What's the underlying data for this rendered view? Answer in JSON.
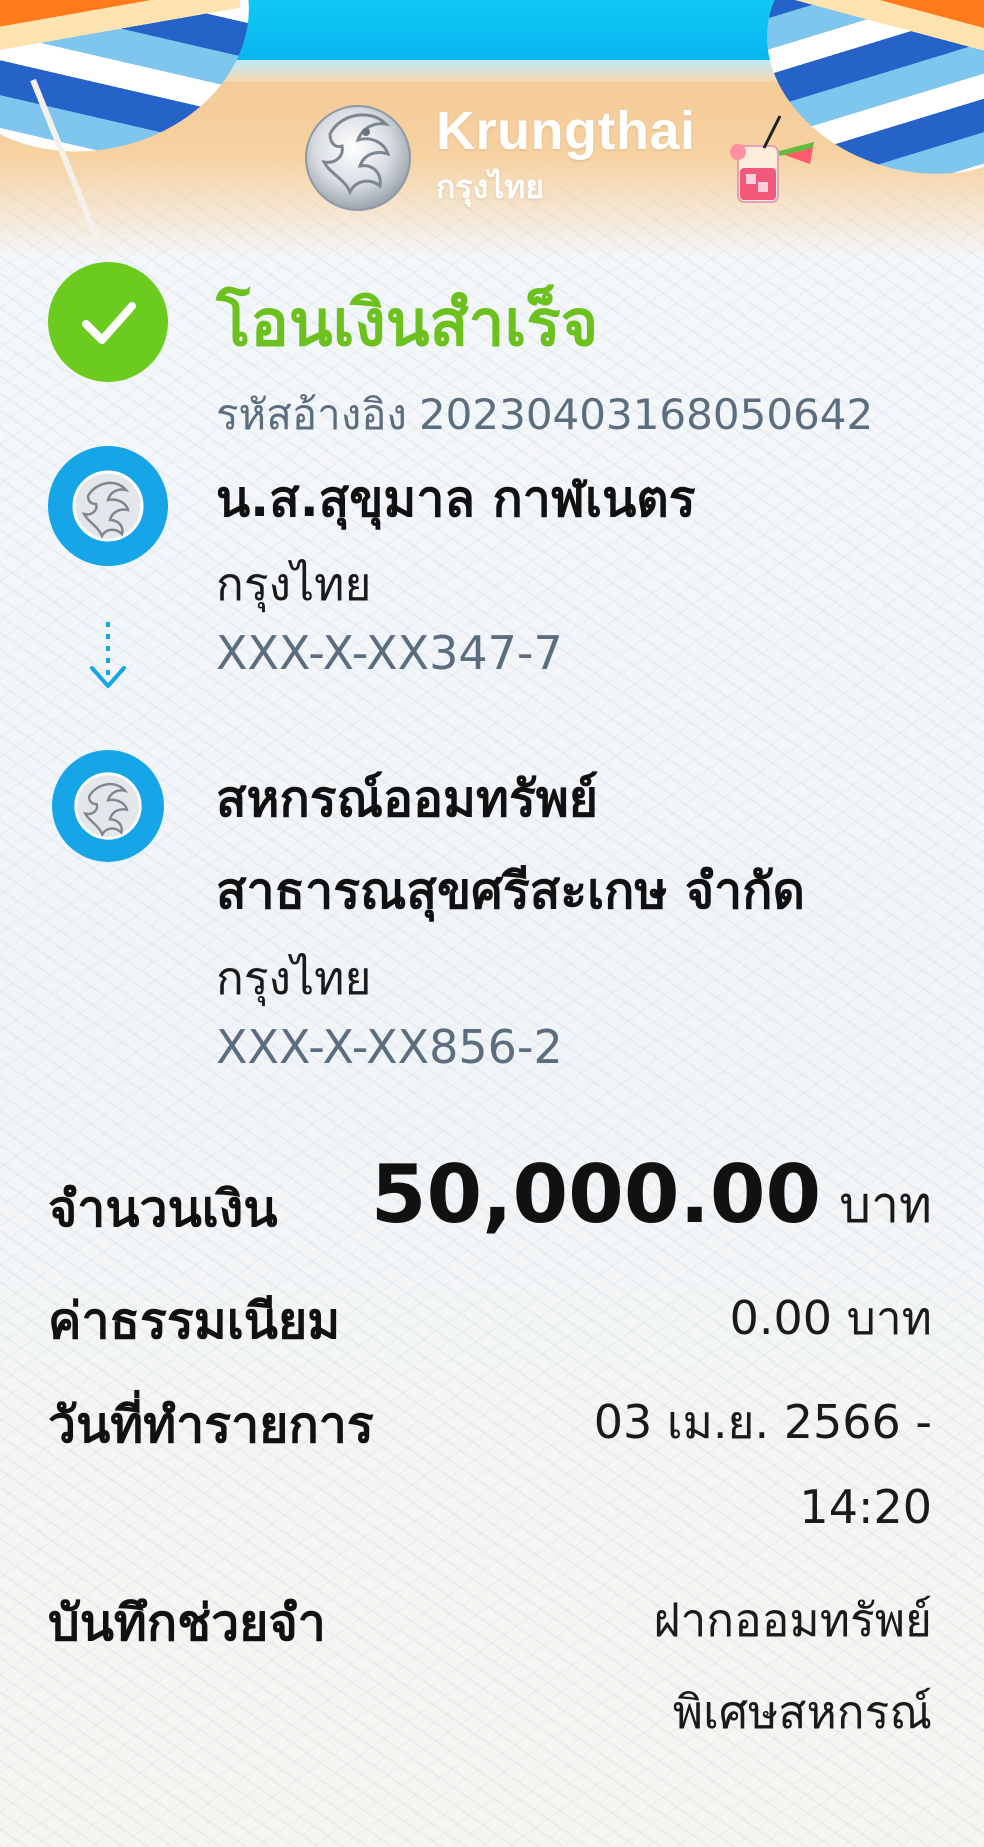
{
  "brand": {
    "name_en": "Krungthai",
    "name_th": "กรุงไทย",
    "colors": {
      "success": "#6cc11e",
      "bank_blue": "#16a6e8",
      "account_gray": "#5d6d80"
    }
  },
  "status": {
    "title": "โอนเงินสำเร็จ",
    "reference_label": "รหัสอ้างอิง",
    "reference_number": "20230403168050642",
    "icon": "check-icon"
  },
  "sender": {
    "name": "น.ส.สุขุมาล กาฬเนตร",
    "bank": "กรุงไทย",
    "account": "XXX-X-XX347-7",
    "icon": "krungthai-logo-icon"
  },
  "receiver": {
    "name_line1": "สหกรณ์ออมทรัพย์",
    "name_line2": "สาธารณสุขศรีสะเกษ จำกัด",
    "bank": "กรุงไทย",
    "account": "XXX-X-XX856-2",
    "icon": "krungthai-logo-icon"
  },
  "details": {
    "amount_label": "จำนวนเงิน",
    "amount_value": "50,000.00",
    "amount_unit": "บาท",
    "fee_label": "ค่าธรรมเนียม",
    "fee_value": "0.00 บาท",
    "date_label": "วันที่ทำรายการ",
    "date_line1": "03 เม.ย. 2566 -",
    "date_line2": "14:20",
    "memo_label": "บันทึกช่วยจำ",
    "memo_line1": "ฝากออมทรัพย์",
    "memo_line2": "พิเศษสหกรณ์"
  }
}
